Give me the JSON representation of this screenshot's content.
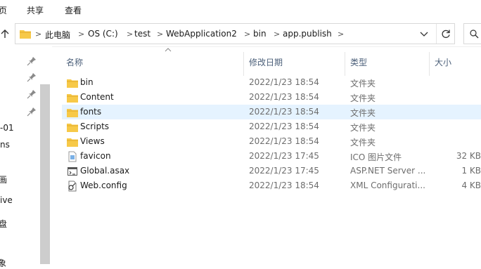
{
  "ribbon": {
    "tab_view_cut": "页",
    "tab_share": "共享",
    "tab_view": "查看"
  },
  "address": {
    "crumbs": [
      "此电脑",
      "OS (C:)",
      "test",
      "WebApplication2",
      "bin",
      "app.publish"
    ],
    "separator": ">"
  },
  "nav": {
    "items": [
      "-01",
      "ns",
      "画",
      "ive",
      "盘",
      "象"
    ]
  },
  "columns": {
    "name": "名称",
    "date": "修改日期",
    "type": "类型",
    "size": "大小"
  },
  "files": [
    {
      "name": "bin",
      "date": "2022/1/23 18:54",
      "type": "文件夹",
      "size": "",
      "icon": "folder-icon"
    },
    {
      "name": "Content",
      "date": "2022/1/23 18:54",
      "type": "文件夹",
      "size": "",
      "icon": "folder-icon"
    },
    {
      "name": "fonts",
      "date": "2022/1/23 18:54",
      "type": "文件夹",
      "size": "",
      "icon": "folder-icon",
      "selected": true
    },
    {
      "name": "Scripts",
      "date": "2022/1/23 18:54",
      "type": "文件夹",
      "size": "",
      "icon": "folder-icon"
    },
    {
      "name": "Views",
      "date": "2022/1/23 18:54",
      "type": "文件夹",
      "size": "",
      "icon": "folder-icon"
    },
    {
      "name": "favicon",
      "date": "2022/1/23 17:45",
      "type": "ICO 图片文件",
      "size": "32 KB",
      "icon": "ico-file-icon"
    },
    {
      "name": "Global.asax",
      "date": "2022/1/23 17:45",
      "type": "ASP.NET Server ...",
      "size": "1 KB",
      "icon": "asax-file-icon"
    },
    {
      "name": "Web.config",
      "date": "2022/1/23 18:54",
      "type": "XML Configurati...",
      "size": "4 KB",
      "icon": "config-file-icon"
    }
  ],
  "colors": {
    "folder": "#f7c948",
    "selection": "#e5f3ff",
    "header_text": "#4c607a"
  }
}
